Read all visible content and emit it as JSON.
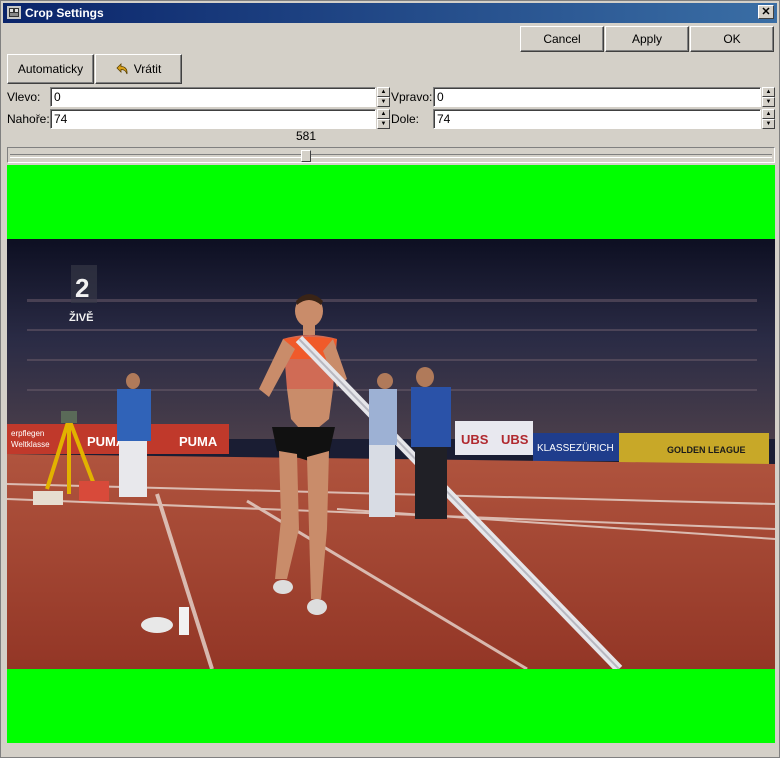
{
  "window": {
    "title": "Crop Settings"
  },
  "buttons": {
    "cancel": "Cancel",
    "apply": "Apply",
    "ok": "OK",
    "auto": "Automaticky",
    "revert": "Vrátit"
  },
  "fields": {
    "left": {
      "label": "Vlevo:",
      "value": "0"
    },
    "right": {
      "label": "Vpravo:",
      "value": "0"
    },
    "top": {
      "label": "Nahoře:",
      "value": "74"
    },
    "bottom": {
      "label": "Dole:",
      "value": "74"
    }
  },
  "slider": {
    "value": "581"
  },
  "video": {
    "channel_number": "2",
    "channel_name": "ŽIVĚ",
    "banners": [
      "erpflegen",
      "Weltklasse",
      "PUMA",
      "PUMA",
      "UBS",
      "UBS",
      "KLASSEZÜRICH",
      "GOLDEN LEAGUE"
    ]
  },
  "colors": {
    "crop_fill": "#00ff00",
    "titlebar": "#0a246a",
    "dialog_bg": "#d4d0c8",
    "track": "#a63a2a"
  }
}
